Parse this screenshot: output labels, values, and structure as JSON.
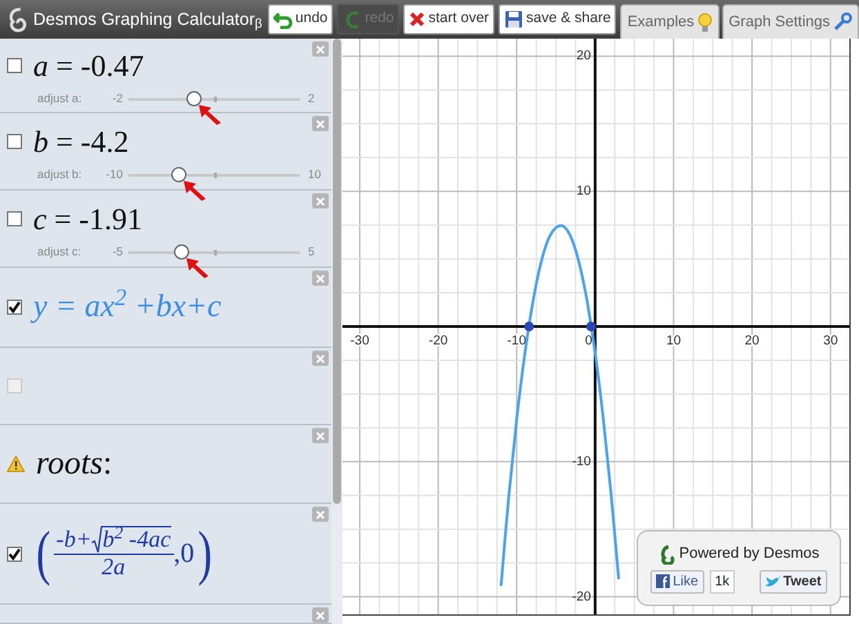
{
  "topbar": {
    "title": "Desmos Graphing Calculator$_{β}$",
    "buttons": [
      {
        "label": "undo",
        "disabled": false
      },
      {
        "label": "redo",
        "disabled": true
      },
      {
        "label": "start over",
        "disabled": false
      },
      {
        "label": "save & share",
        "disabled": false
      }
    ],
    "tabs": [
      {
        "label": "Examples",
        "selected": false
      },
      {
        "label": "Graph Settings",
        "selected": false
      }
    ]
  },
  "expressions": [
    {
      "kind": "slider",
      "checked": false,
      "variable": "a",
      "value": "= -0.47",
      "adjust_label": "adjust a:",
      "min": "-2",
      "max": "2",
      "level": 0.3825,
      "arrow": true
    },
    {
      "kind": "slider",
      "checked": false,
      "variable": "b",
      "value": "= -4.2",
      "adjust_label": "adjust b:",
      "min": "-10",
      "max": "10",
      "level": 0.29,
      "arrow": true
    },
    {
      "kind": "slider",
      "checked": false,
      "variable": "c",
      "value": "= -1.91",
      "adjust_label": "adjust c:",
      "min": "-5",
      "max": "5",
      "level": 0.309,
      "arrow": true
    },
    {
      "kind": "function",
      "checked": true,
      "math": "y = ax$^{2}$ +bx+c"
    },
    {
      "kind": "empty",
      "checked": false,
      "disabled": true
    },
    {
      "kind": "text",
      "warning": true,
      "math": "*roots*:"
    },
    {
      "kind": "point",
      "checked": true,
      "open": "(",
      "numerator": "-b+",
      "radicand": "b$^{2}$ -4ac",
      "denominator": "2a",
      "tail": ",0",
      "close": ")"
    },
    {
      "kind": "partial"
    }
  ],
  "graph": {
    "chart_data": {
      "type": "line",
      "x": [
        -12,
        -11,
        -10,
        -9,
        -8,
        -7,
        -6,
        -5,
        -4,
        -3,
        -2,
        -1,
        0,
        1,
        2,
        3
      ],
      "series": [
        {
          "values": [
            -19.2,
            -12.6,
            -6.9,
            -2.2,
            1.6,
            4.5,
            6.4,
            7.3,
            7.4,
            6.5,
            4.6,
            1.8,
            -1.9,
            -6.6,
            -12.2,
            -18.7
          ]
        }
      ],
      "xlim": [
        -32.2,
        32.4
      ],
      "ylim": [
        -21.3,
        21.3
      ],
      "xticks": [
        -30,
        -20,
        -10,
        0,
        10,
        20,
        30
      ],
      "yticks": [
        -20,
        -10,
        10,
        20
      ],
      "grid": true
    },
    "powered": {
      "text": "Powered by Desmos",
      "like": "Like",
      "count": "1k",
      "tweet": "Tweet"
    }
  }
}
